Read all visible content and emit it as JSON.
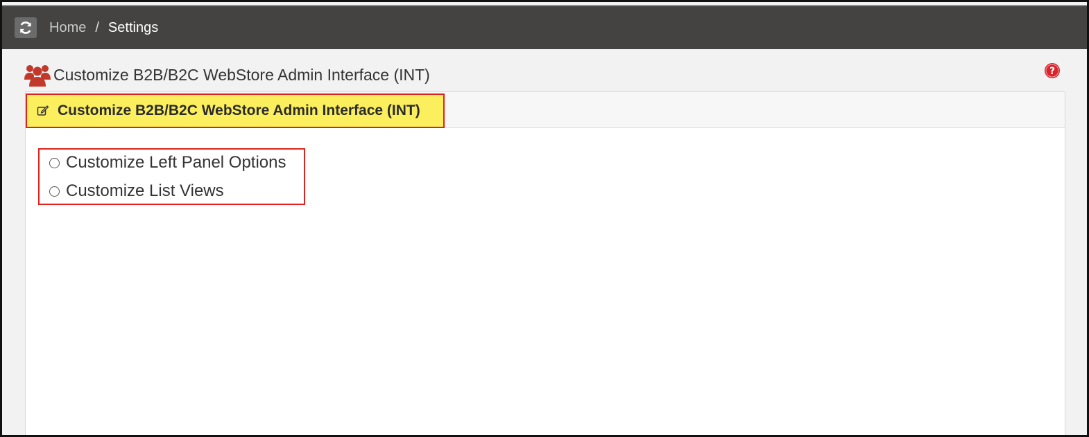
{
  "breadcrumb": {
    "home": "Home",
    "separator": "/",
    "current": "Settings"
  },
  "page": {
    "title": "Customize B2B/B2C WebStore Admin Interface (INT)",
    "title_icon": "users-icon",
    "help_icon": "question-circle-icon"
  },
  "panel": {
    "header_title": "Customize B2B/B2C WebStore Admin Interface (INT)",
    "header_icon": "edit-icon",
    "options": [
      {
        "label": "Customize Left Panel Options",
        "selected": false
      },
      {
        "label": "Customize List Views",
        "selected": false
      }
    ]
  },
  "colors": {
    "topbar": "#444341",
    "highlight": "#fbef5d",
    "annotation_border": "#e2211c",
    "users_icon": "#c0392b",
    "help_icon": "#d9232d"
  }
}
